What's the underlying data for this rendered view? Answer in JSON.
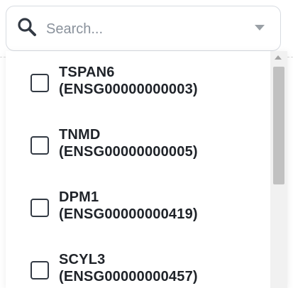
{
  "search": {
    "placeholder": "Search..."
  },
  "icons": {
    "search": "search-icon",
    "dropdown": "chevron-down-icon",
    "scroll_up": "arrow-up-icon"
  },
  "options": [
    {
      "name": "TSPAN6",
      "id": "(ENSG00000000003)",
      "checked": false
    },
    {
      "name": "TNMD",
      "id": "(ENSG00000000005)",
      "checked": false
    },
    {
      "name": "DPM1",
      "id": "(ENSG00000000419)",
      "checked": false
    },
    {
      "name": "SCYL3",
      "id": "(ENSG00000000457)",
      "checked": false
    }
  ],
  "colors": {
    "text": "#1f2329",
    "border": "#d7dbe1",
    "placeholder": "#8a929c",
    "scroll_thumb": "#c1c1c1"
  }
}
